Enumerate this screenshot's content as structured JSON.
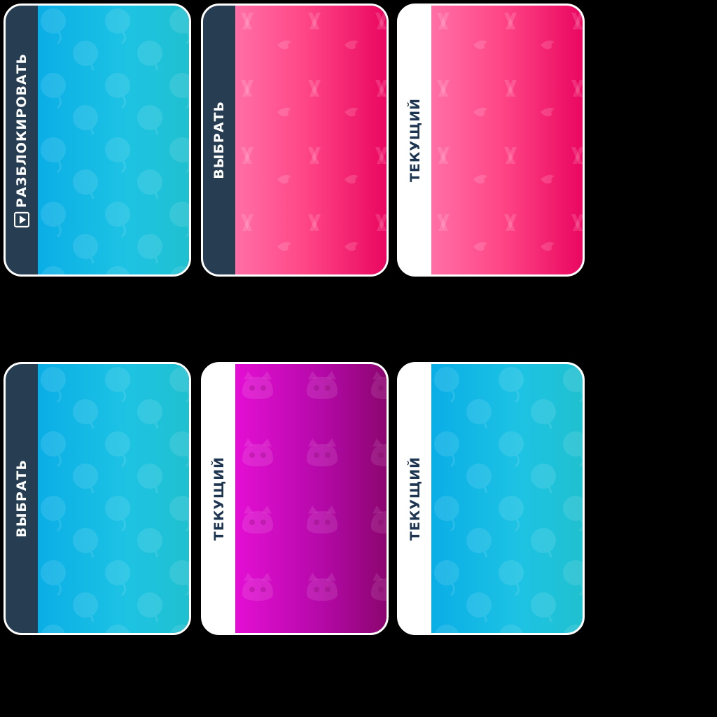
{
  "cards": [
    {
      "label": "РАЗБЛОКИРОВАТЬ",
      "tab": "dark",
      "skin": "blue",
      "pattern": "balloon-pattern",
      "icon": "video-play-icon"
    },
    {
      "label": "ВЫБРАТЬ",
      "tab": "dark",
      "skin": "pink",
      "pattern": "flame-logo-pattern"
    },
    {
      "label": "ТЕКУЩИЙ",
      "tab": "white",
      "skin": "pink",
      "pattern": "flame-logo-pattern"
    },
    {
      "label": "ВЫБРАТЬ",
      "tab": "dark",
      "skin": "blue",
      "pattern": "balloon-pattern"
    },
    {
      "label": "ТЕКУЩИЙ",
      "tab": "white",
      "skin": "magenta",
      "pattern": "cat-face-pattern"
    },
    {
      "label": "ТЕКУЩИЙ",
      "tab": "white",
      "skin": "blue",
      "pattern": "balloon-pattern"
    }
  ],
  "colors": {
    "tab_dark": "#263d52",
    "tab_white": "#ffffff",
    "blue": "#1ec3e3",
    "pink": "#ff4787",
    "magenta": "#b609aa"
  }
}
